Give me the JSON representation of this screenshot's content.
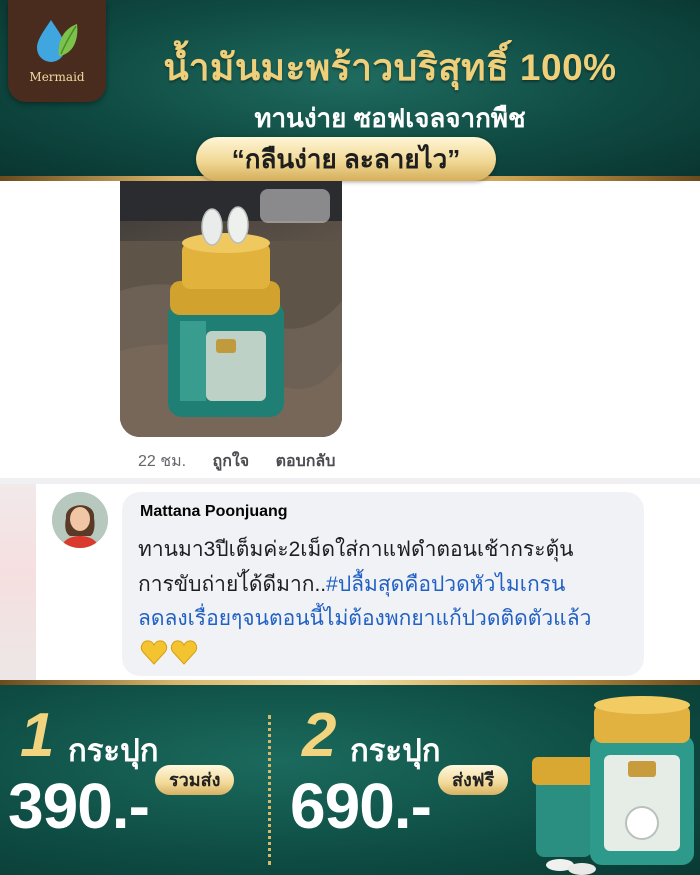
{
  "colors": {
    "brand_green": "#0f4b43",
    "gold": "#f0cf7a",
    "hashtag_blue": "#2160c4",
    "bubble_bg": "#f0f2f5"
  },
  "header": {
    "logo_text": "Mermaid",
    "logo_icon": "water-drop-leaf-icon",
    "headline": "น้ำมันมะพร้าวบริสุทธิ์ 100%",
    "subline": "ทานง่าย ซอฟเจลจากพืช",
    "slogan": "“กลืนง่าย ละลายไว”"
  },
  "post": {
    "time": "22 ชม.",
    "like_label": "ถูกใจ",
    "reply_label": "ตอบกลับ"
  },
  "comment": {
    "author": "Mattana Poonjuang",
    "line1": "ทานมา3ปีเต็มค่ะ2เม็ดใส่กาแฟดำตอนเช้ากระตุ้น",
    "line2_plain": "การขับถ่ายไ้ด้ดีมาก..",
    "line2_tag": "#ปลื้มสุดคือปวดหัวไมเกรน",
    "line3_tag": "ลดลงเรื่อยๆจนตอนนี้ไม่ต้องพกยาแก้ปวดติดตัวแล้ว",
    "emoji": "💛💛"
  },
  "offers": [
    {
      "qty": "1",
      "unit": "กระปุก",
      "price": "390.-",
      "tag": "รวมส่ง"
    },
    {
      "qty": "2",
      "unit": "กระปุก",
      "price": "690.-",
      "tag": "ส่งฟรี"
    }
  ]
}
